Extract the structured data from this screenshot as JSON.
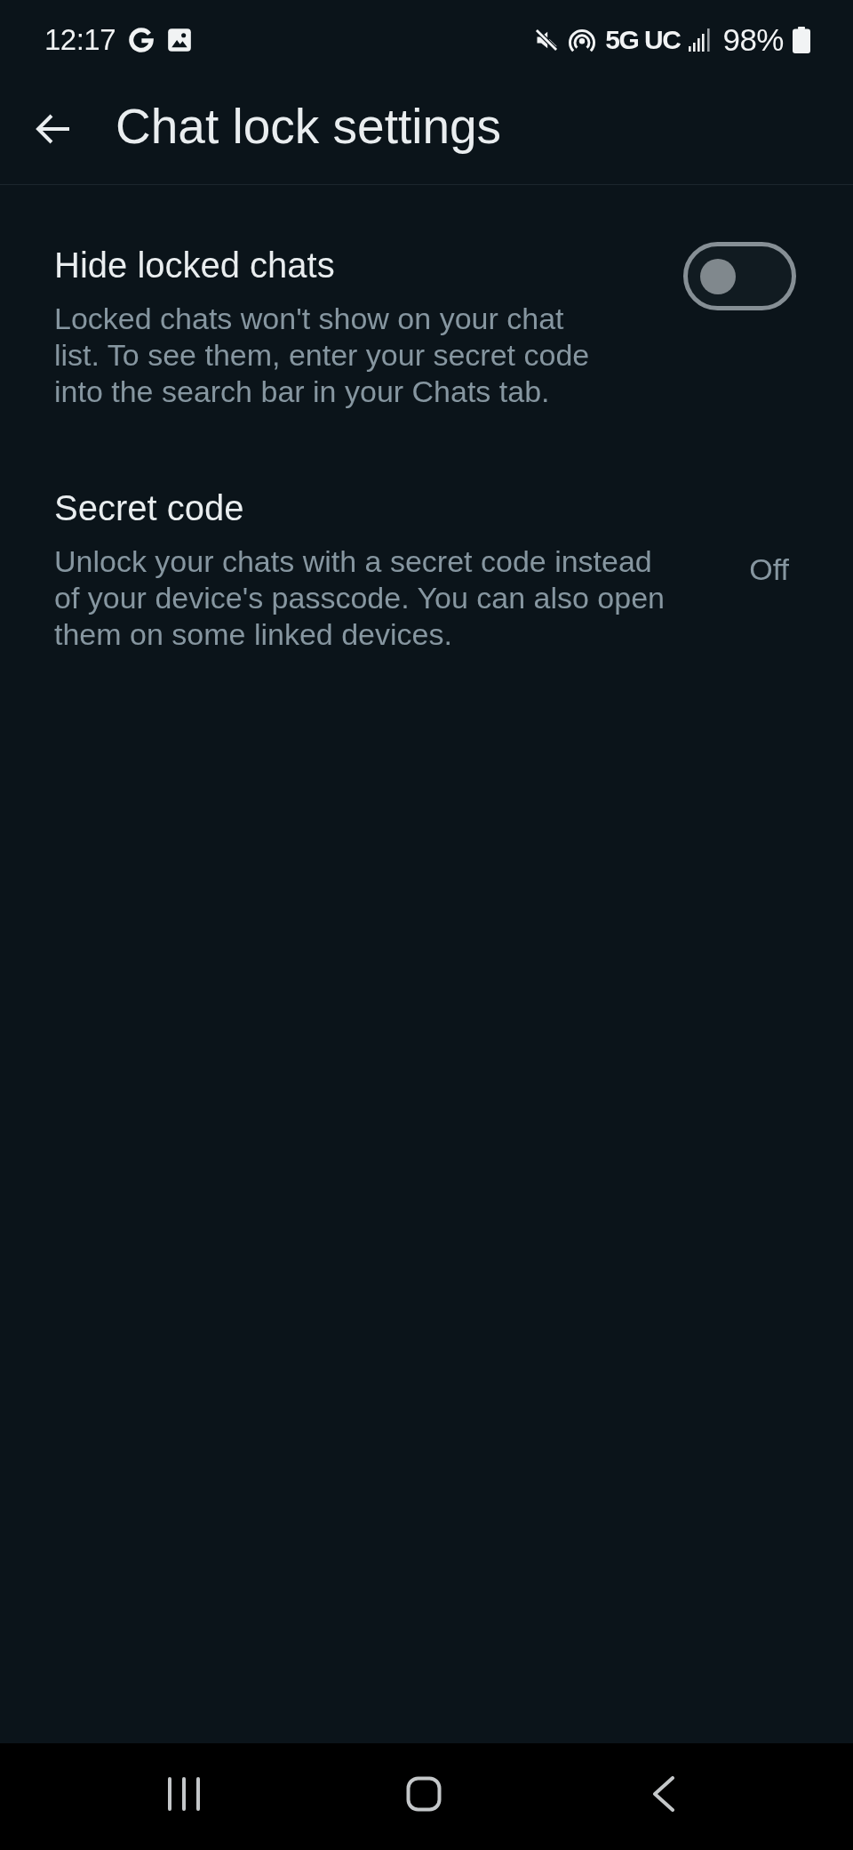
{
  "status_bar": {
    "time": "12:17",
    "network": "5G UC",
    "battery": "98%"
  },
  "header": {
    "title": "Chat lock settings"
  },
  "settings": [
    {
      "kind": "toggle",
      "title": "Hide locked chats",
      "description": "Locked chats won't show on your chat list. To see them, enter your secret code into the search bar in your Chats tab.",
      "on": false
    },
    {
      "kind": "value",
      "title": "Secret code",
      "description": "Unlock your chats with a secret code instead of your device's passcode. You can also open them on some linked devices.",
      "value": "Off"
    }
  ]
}
